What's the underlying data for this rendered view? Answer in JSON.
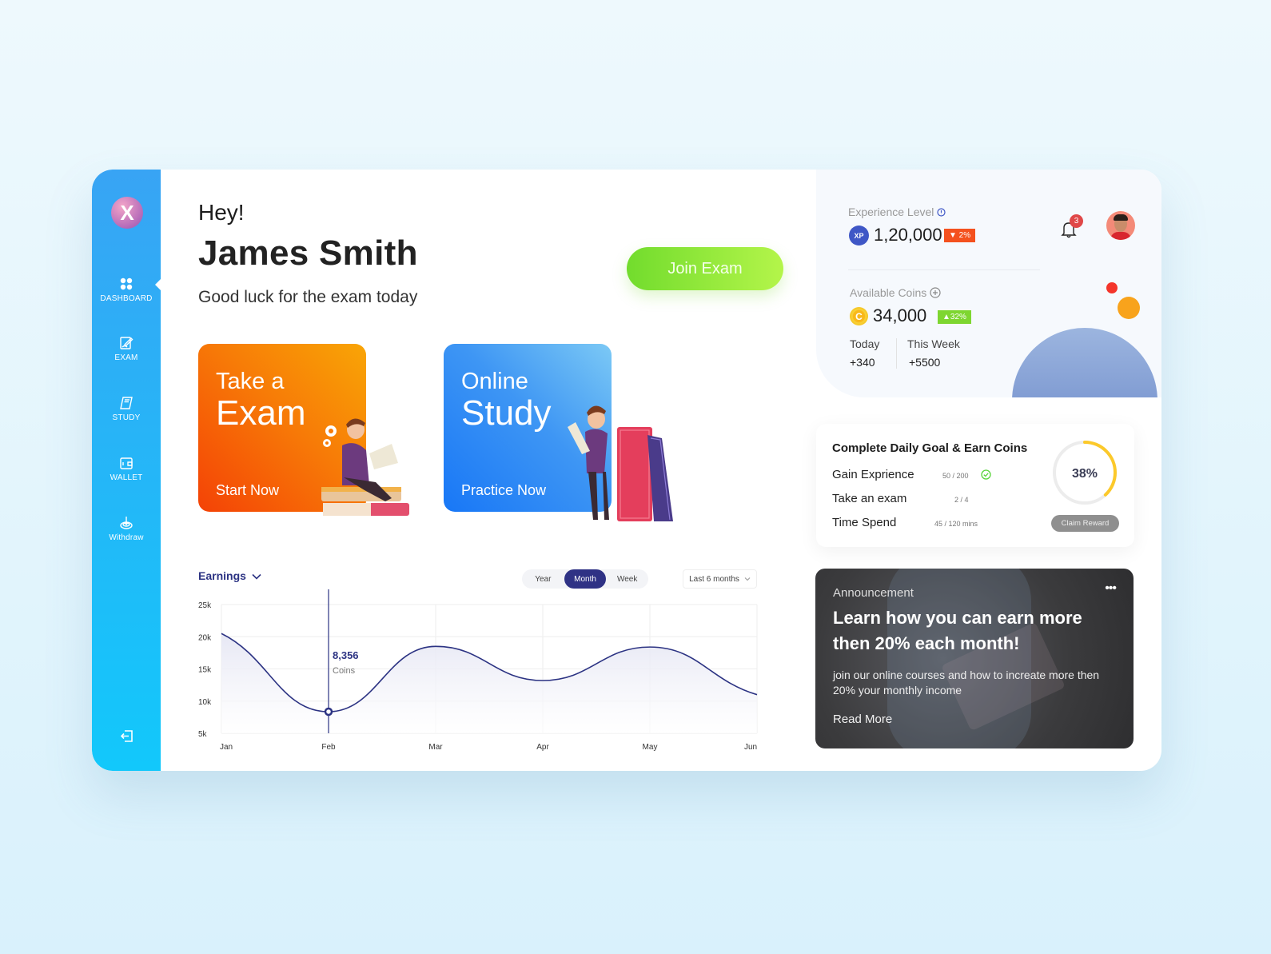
{
  "app": {
    "logo_letter": "X"
  },
  "sidebar": {
    "items": [
      {
        "label": "DASHBOARD",
        "icon": "grid-icon",
        "active": true
      },
      {
        "label": "EXAM",
        "icon": "exam-icon"
      },
      {
        "label": "STUDY",
        "icon": "book-icon"
      },
      {
        "label": "WALLET",
        "icon": "wallet-icon"
      },
      {
        "label": "Withdraw",
        "icon": "withdraw-icon"
      }
    ],
    "logout_icon": "logout-icon"
  },
  "greeting": {
    "hey": "Hey!",
    "name": "James Smith",
    "subtitle": "Good luck for the exam today",
    "join_button": "Join Exam"
  },
  "cards": [
    {
      "line1": "Take a",
      "line2": "Exam",
      "cta": "Start Now",
      "colors": [
        "#f44206",
        "#f9a506"
      ]
    },
    {
      "line1": "Online",
      "line2": "Study",
      "cta": "Practice Now",
      "colors": [
        "#1877f6",
        "#7cc9f5"
      ]
    }
  ],
  "earnings": {
    "title": "Earnings",
    "segments": [
      "Year",
      "Month",
      "Week"
    ],
    "active_segment": "Month",
    "range": "Last 6 months"
  },
  "chart_data": {
    "type": "line",
    "title": "Earnings",
    "categories": [
      "Jan",
      "Feb",
      "Mar",
      "Apr",
      "May",
      "Jun"
    ],
    "series": [
      {
        "name": "Coins",
        "values": [
          20500,
          8356,
          18500,
          13200,
          18400,
          11000
        ],
        "color": "#2c3383"
      }
    ],
    "y_ticks": [
      "25k",
      "20k",
      "15k",
      "10k",
      "5k"
    ],
    "ylim": [
      5000,
      25000
    ],
    "grid": true,
    "tooltip": {
      "category": "Feb",
      "value": "8,356",
      "unit": "Coins"
    }
  },
  "stats": {
    "experience_label": "Experience Level",
    "experience_value": "1,20,000",
    "experience_badge": "▼ 2%",
    "xp_icon": "XP",
    "coins_label": "Available Coins",
    "coins_value": "34,000",
    "coins_badge": "▲32%",
    "coin_icon": "C",
    "today_label": "Today",
    "today_value": "+340",
    "week_label": "This Week",
    "week_value": "+5500",
    "notification_count": "3",
    "colors": {
      "down": "#f4511e",
      "up": "#7ed630",
      "xp": "#3f57c6",
      "coin": "#f7c21a"
    }
  },
  "daily_goal": {
    "title": "Complete Daily Goal & Earn Coins",
    "items": [
      {
        "label": "Gain Exprience",
        "value": "50 / 200",
        "done": true
      },
      {
        "label": "Take an exam",
        "value": "2 / 4",
        "done": false
      },
      {
        "label": "Time Spend",
        "value": "45 / 120 mins",
        "done": false
      }
    ],
    "progress_label": "38%",
    "progress": 0.38,
    "claim_button": "Claim Reward"
  },
  "announcement": {
    "label": "Announcement",
    "title": "Learn how you can earn more then 20% each month!",
    "body": "join our online courses and how to increate more then 20% your monthly income",
    "link": "Read More",
    "menu": "•••"
  }
}
